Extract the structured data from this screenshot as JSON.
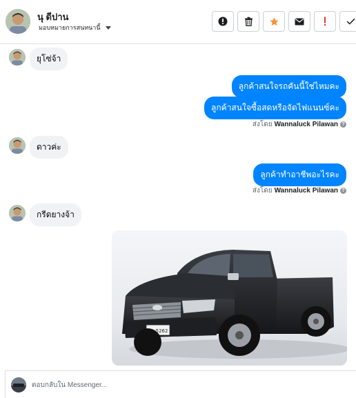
{
  "header": {
    "name": "นุ ดีปาน",
    "assign_label": "มอบหมายการสนทนานี้",
    "actions": [
      {
        "icon": "alert-circle-icon"
      },
      {
        "icon": "trash-icon"
      },
      {
        "icon": "star-icon"
      },
      {
        "icon": "envelope-icon"
      },
      {
        "icon": "exclamation-icon"
      },
      {
        "icon": "checkmark-icon"
      }
    ],
    "star_color": "#f7923b",
    "warn_color": "#e4302d"
  },
  "messages": {
    "in1": "ยุโซ่จ้า",
    "out1": "ลูกค้าสนใจรถคันนี้ใช่ไหมคะ",
    "out2": "ลูกค้าสนใจซื้อสดหรือจัดไฟแนนซ์คะ",
    "sent_prefix": "ส่งโดย",
    "sender": "Wannaluck Pilawan",
    "in2": "ดาวค่ะ",
    "out3": "ลูกค้าทำอาชีพอะไรคะ",
    "in3": "กรีดยางจ้า",
    "photo_icon": "toyota-pickup-truck-photo",
    "plate": "ผข 5262"
  },
  "composer": {
    "placeholder": "ตอบกลับใน Messenger..."
  },
  "colors": {
    "outgoing_bubble": "#0084ff",
    "incoming_bubble": "#f0f2f5"
  }
}
